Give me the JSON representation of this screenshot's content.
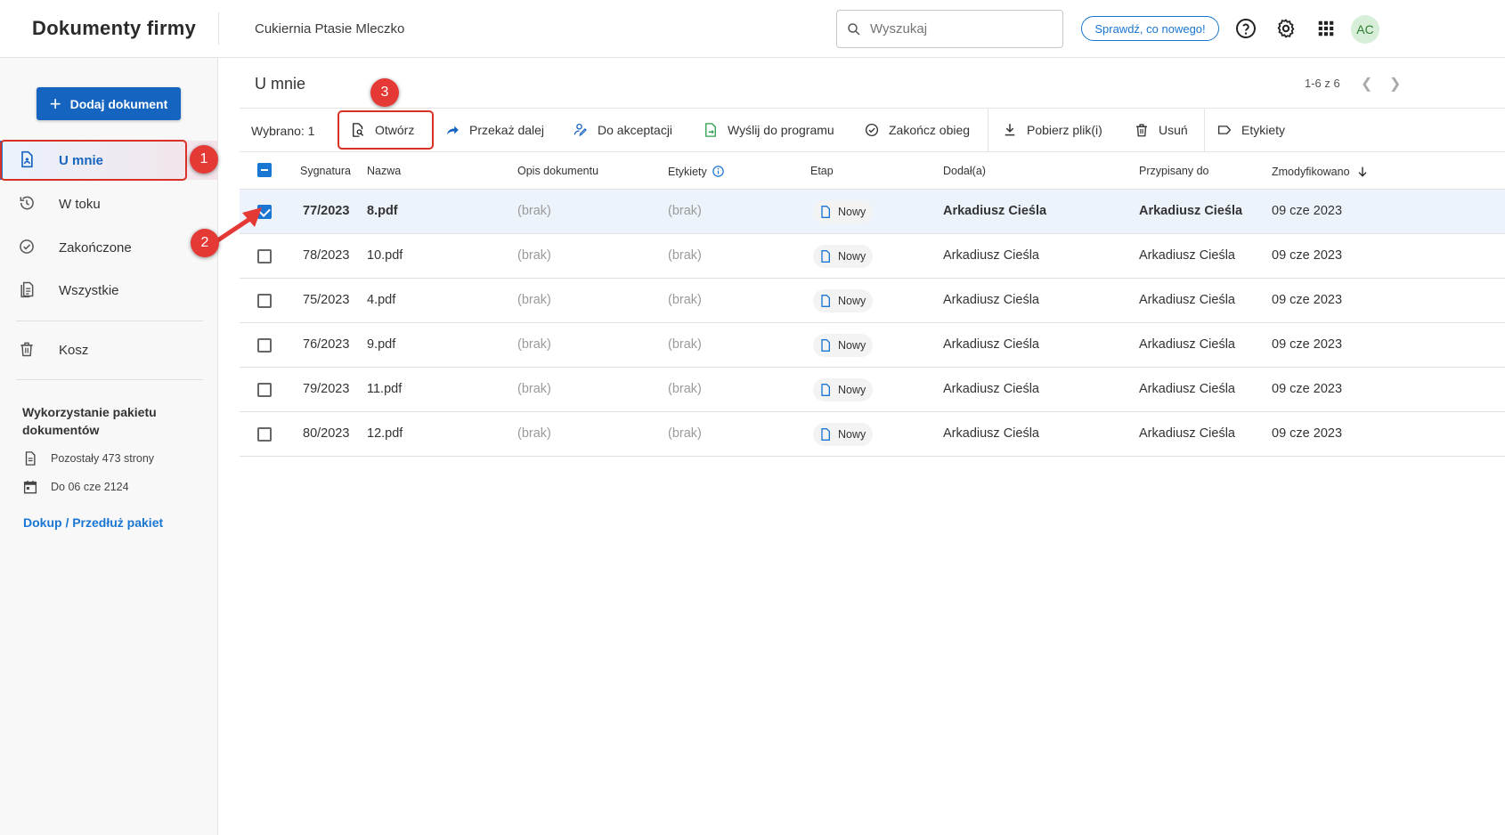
{
  "header": {
    "app_title": "Dokumenty firmy",
    "company": "Cukiernia Ptasie Mleczko",
    "search_placeholder": "Wyszukaj",
    "whats_new": "Sprawdź, co nowego!",
    "avatar_initials": "AC"
  },
  "sidebar": {
    "add_button": "Dodaj dokument",
    "items": [
      {
        "label": "U mnie",
        "icon": "document-user-icon",
        "active": true
      },
      {
        "label": "W toku",
        "icon": "history-icon"
      },
      {
        "label": "Zakończone",
        "icon": "check-circle-icon"
      },
      {
        "label": "Wszystkie",
        "icon": "documents-icon"
      },
      {
        "label": "Kosz",
        "icon": "trash-icon"
      }
    ],
    "usage_title": "Wykorzystanie pakietu dokumentów",
    "pages_left": "Pozostały 473 strony",
    "valid_until": "Do 06 cze 2124",
    "extend_link": "Dokup / Przedłuż pakiet"
  },
  "main": {
    "title": "U mnie",
    "pagination": "1-6 z 6"
  },
  "toolbar": {
    "selected": "Wybrano: 1",
    "open": "Otwórz",
    "forward": "Przekaż dalej",
    "approve": "Do akceptacji",
    "send": "Wyślij do programu",
    "finish": "Zakończ obieg",
    "download": "Pobierz plik(i)",
    "delete": "Usuń",
    "labels": "Etykiety"
  },
  "table": {
    "columns": {
      "signature": "Sygnatura",
      "name": "Nazwa",
      "description": "Opis dokumentu",
      "labels": "Etykiety",
      "stage": "Etap",
      "added_by": "Dodał(a)",
      "assigned_to": "Przypisany do",
      "modified": "Zmodyfikowano"
    },
    "rows": [
      {
        "signature": "77/2023",
        "name": "8.pdf",
        "description": "(brak)",
        "labels": "(brak)",
        "stage": "Nowy",
        "added_by": "Arkadiusz Cieśla",
        "assigned_to": "Arkadiusz Cieśla",
        "modified": "09 cze 2023",
        "checked": true
      },
      {
        "signature": "78/2023",
        "name": "10.pdf",
        "description": "(brak)",
        "labels": "(brak)",
        "stage": "Nowy",
        "added_by": "Arkadiusz Cieśla",
        "assigned_to": "Arkadiusz Cieśla",
        "modified": "09 cze 2023",
        "checked": false
      },
      {
        "signature": "75/2023",
        "name": "4.pdf",
        "description": "(brak)",
        "labels": "(brak)",
        "stage": "Nowy",
        "added_by": "Arkadiusz Cieśla",
        "assigned_to": "Arkadiusz Cieśla",
        "modified": "09 cze 2023",
        "checked": false
      },
      {
        "signature": "76/2023",
        "name": "9.pdf",
        "description": "(brak)",
        "labels": "(brak)",
        "stage": "Nowy",
        "added_by": "Arkadiusz Cieśla",
        "assigned_to": "Arkadiusz Cieśla",
        "modified": "09 cze 2023",
        "checked": false
      },
      {
        "signature": "79/2023",
        "name": "11.pdf",
        "description": "(brak)",
        "labels": "(brak)",
        "stage": "Nowy",
        "added_by": "Arkadiusz Cieśla",
        "assigned_to": "Arkadiusz Cieśla",
        "modified": "09 cze 2023",
        "checked": false
      },
      {
        "signature": "80/2023",
        "name": "12.pdf",
        "description": "(brak)",
        "labels": "(brak)",
        "stage": "Nowy",
        "added_by": "Arkadiusz Cieśla",
        "assigned_to": "Arkadiusz Cieśla",
        "modified": "09 cze 2023",
        "checked": false
      }
    ]
  },
  "annotations": {
    "step1": "1",
    "step2": "2",
    "step3": "3"
  },
  "colors": {
    "accent": "#1976d2",
    "primary_button": "#1565c0",
    "annotation": "#e53935",
    "selected_row": "#edf3fb"
  }
}
